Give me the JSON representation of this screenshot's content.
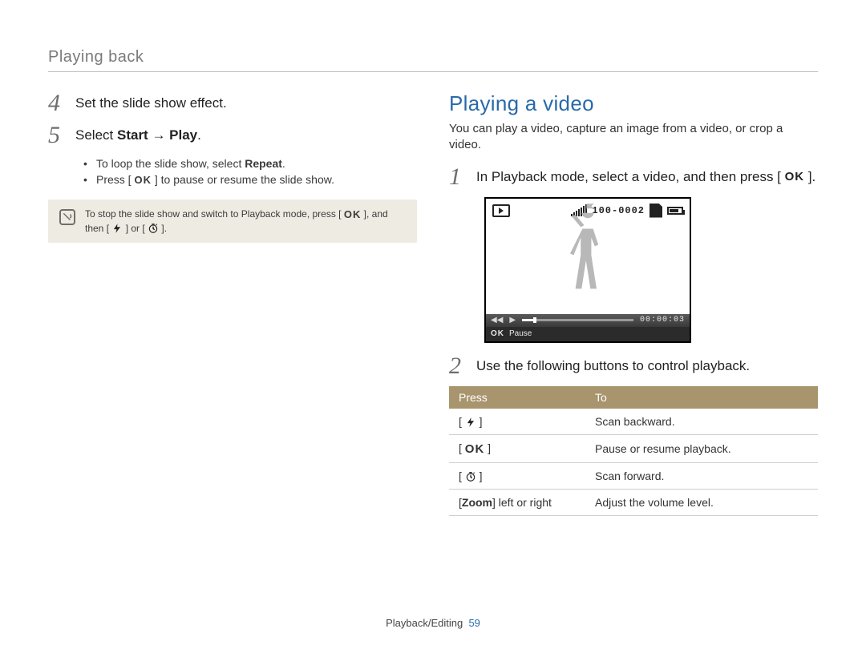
{
  "header": {
    "breadcrumb": "Playing back"
  },
  "left": {
    "step4": {
      "num": "4",
      "text": "Set the slide show effect."
    },
    "step5": {
      "num": "5",
      "text_prefix": "Select ",
      "text_bold": "Start → Play",
      "text_suffix": "."
    },
    "bullets": {
      "b1_prefix": "To loop the slide show, select ",
      "b1_bold": "Repeat",
      "b1_suffix": ".",
      "b2_prefix": "Press [ ",
      "b2_ok": "OK",
      "b2_suffix": " ] to pause or resume the slide show."
    },
    "note": {
      "prefix": "To stop the slide show and switch to Playback mode, press [ ",
      "ok": "OK",
      "mid": " ], and then [ ",
      "or": " ] or [ ",
      "end": " ]."
    }
  },
  "right": {
    "title": "Playing a video",
    "intro": "You can play a video, capture an image from a video, or crop a video.",
    "step1": {
      "num": "1",
      "prefix": "In Playback mode, select a video, and then press [ ",
      "ok": "OK",
      "suffix": " ]."
    },
    "shot": {
      "file_counter": "100-0002",
      "elapsed": "00:00:03",
      "pause_ok": "OK",
      "pause_label": "Pause"
    },
    "step2": {
      "num": "2",
      "text": "Use the following buttons to control playback."
    },
    "table": {
      "h_press": "Press",
      "h_to": "To",
      "rows": {
        "r1": {
          "to": "Scan backward."
        },
        "r2": {
          "press": "OK",
          "to": "Pause or resume playback."
        },
        "r3": {
          "to": "Scan forward."
        },
        "r4": {
          "press_prefix": "[",
          "press_bold": "Zoom",
          "press_suffix": "] left or right",
          "to": "Adjust the volume level."
        }
      }
    }
  },
  "footer": {
    "section": "Playback/Editing",
    "page": "59"
  }
}
